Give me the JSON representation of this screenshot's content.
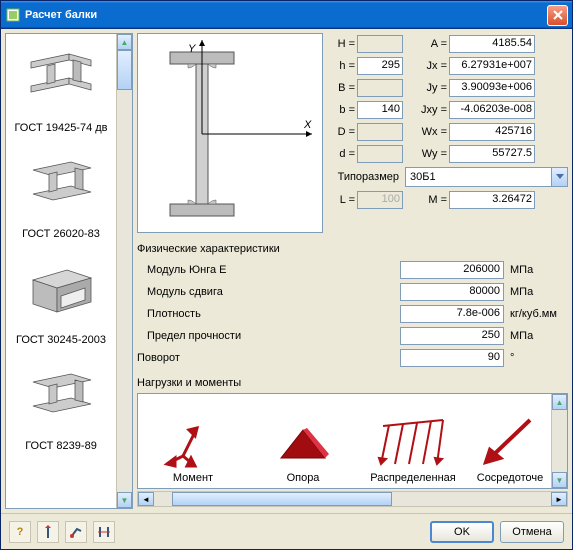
{
  "window": {
    "title": "Расчет балки"
  },
  "sidebar": {
    "items": [
      {
        "label": "ГОСТ 19425-74 дв"
      },
      {
        "label": "ГОСТ 26020-83"
      },
      {
        "label": "ГОСТ 30245-2003"
      },
      {
        "label": "ГОСТ 8239-89"
      }
    ]
  },
  "params": {
    "H": {
      "label": "H =",
      "value": ""
    },
    "h": {
      "label": "h =",
      "value": "295"
    },
    "B": {
      "label": "B =",
      "value": ""
    },
    "b": {
      "label": "b =",
      "value": "140"
    },
    "D": {
      "label": "D =",
      "value": ""
    },
    "d": {
      "label": "d =",
      "value": ""
    },
    "A": {
      "label": "A =",
      "value": "4185.54"
    },
    "Jx": {
      "label": "Jx =",
      "value": "6.27931e+007"
    },
    "Jy": {
      "label": "Jy =",
      "value": "3.90093e+006"
    },
    "Jxy": {
      "label": "Jxy =",
      "value": "-4.06203e-008"
    },
    "Wx": {
      "label": "Wx =",
      "value": "425716"
    },
    "Wy": {
      "label": "Wy =",
      "value": "55727.5"
    },
    "L": {
      "label": "L =",
      "value": "100"
    },
    "M": {
      "label": "M =",
      "value": "3.26472"
    },
    "typo_label": "Типоразмер",
    "typo_value": "30Б1"
  },
  "phys": {
    "title": "Физические характеристики",
    "E": {
      "label": "Модуль Юнга E",
      "value": "206000",
      "unit": "МПа"
    },
    "G": {
      "label": "Модуль сдвига",
      "value": "80000",
      "unit": "МПа"
    },
    "rho": {
      "label": "Плотность",
      "value": "7.8e-006",
      "unit": "кг/куб.мм"
    },
    "str": {
      "label": "Предел прочности",
      "value": "250",
      "unit": "МПа"
    },
    "rot": {
      "label": "Поворот",
      "value": "90",
      "unit": "°"
    }
  },
  "loads": {
    "title": "Нагрузки и моменты",
    "items": [
      {
        "label": "Момент"
      },
      {
        "label": "Опора"
      },
      {
        "label": "Распределенная"
      },
      {
        "label": "Сосредоточе"
      }
    ]
  },
  "footer": {
    "ok": "OK",
    "cancel": "Отмена"
  }
}
